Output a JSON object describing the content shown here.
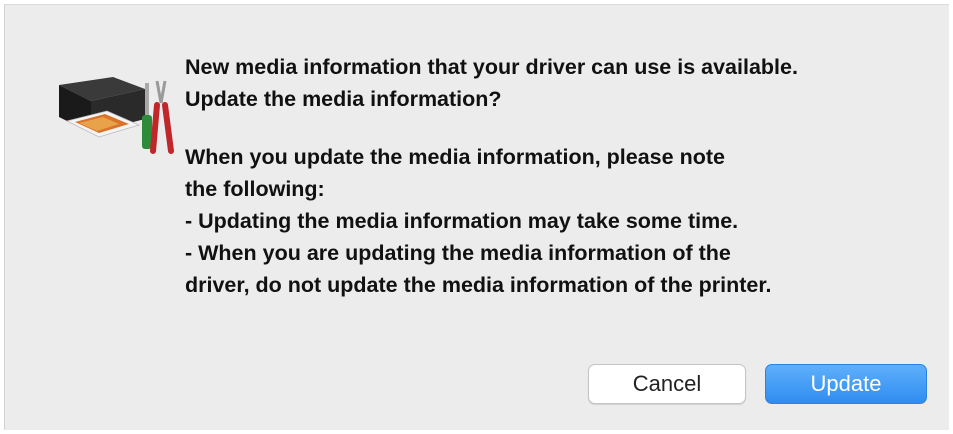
{
  "dialog": {
    "icon": "printer-with-tools-icon",
    "question_lines": [
      "New media information that your driver can use is available.",
      "Update the media information?"
    ],
    "note_lines": [
      "When you update the media information, please note",
      "the following:",
      "- Updating the media information may take some time.",
      "- When you are updating the media information of the",
      "driver, do not update the media information of the printer."
    ],
    "buttons": {
      "cancel_label": "Cancel",
      "update_label": "Update"
    },
    "colors": {
      "background": "#ececec",
      "primary_button": "#3a94f2",
      "primary_text": "#ffffff"
    }
  }
}
